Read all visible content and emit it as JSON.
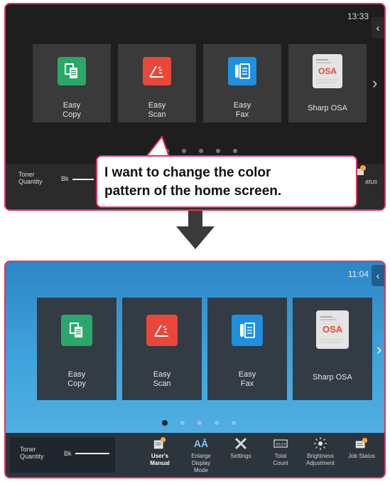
{
  "top_screen": {
    "clock": "13:33",
    "tiles": [
      {
        "line1": "Easy",
        "line2": "Copy",
        "icon": "copy-icon",
        "color": "#2aa86b"
      },
      {
        "line1": "Easy",
        "line2": "Scan",
        "icon": "scan-icon",
        "color": "#e8473a"
      },
      {
        "line1": "Easy",
        "line2": "Fax",
        "icon": "fax-icon",
        "color": "#1f8fe0"
      },
      {
        "line1": "Sharp OSA",
        "line2": "",
        "icon": "osa-icon",
        "color": "#dcdcdc"
      }
    ],
    "toner_label": "Toner\nQuantity",
    "toner_color": "Bk",
    "job_status_partial": "atus"
  },
  "callout": {
    "text_line1": "I want to change the color",
    "text_line2": "pattern of the home screen."
  },
  "bottom_screen": {
    "clock": "11:04",
    "tiles": [
      {
        "line1": "Easy",
        "line2": "Copy",
        "icon": "copy-icon",
        "color": "#2aa86b"
      },
      {
        "line1": "Easy",
        "line2": "Scan",
        "icon": "scan-icon",
        "color": "#e8473a"
      },
      {
        "line1": "Easy",
        "line2": "Fax",
        "icon": "fax-icon",
        "color": "#1f8fe0"
      },
      {
        "line1": "Sharp OSA",
        "line2": "",
        "icon": "osa-icon",
        "color": "#dcdcdc"
      }
    ],
    "toner_label": "Toner\nQuantity",
    "toner_color": "Bk",
    "bar_items": [
      {
        "label": "User's\nManual",
        "icon": "manual-icon"
      },
      {
        "label": "Enlarge\nDisplay\nMode",
        "icon": "enlarge-text-icon"
      },
      {
        "label": "Settings",
        "icon": "settings-icon"
      },
      {
        "label": "Total\nCount",
        "icon": "counter-icon"
      },
      {
        "label": "Brightness\nAdjustment",
        "icon": "brightness-icon"
      },
      {
        "label": "Job Status",
        "icon": "job-status-icon"
      }
    ]
  },
  "colors": {
    "highlight_border": "#e8305a",
    "dark_theme_bg": "#1e1e1e",
    "blue_theme_bg": "#3fa3dc"
  }
}
